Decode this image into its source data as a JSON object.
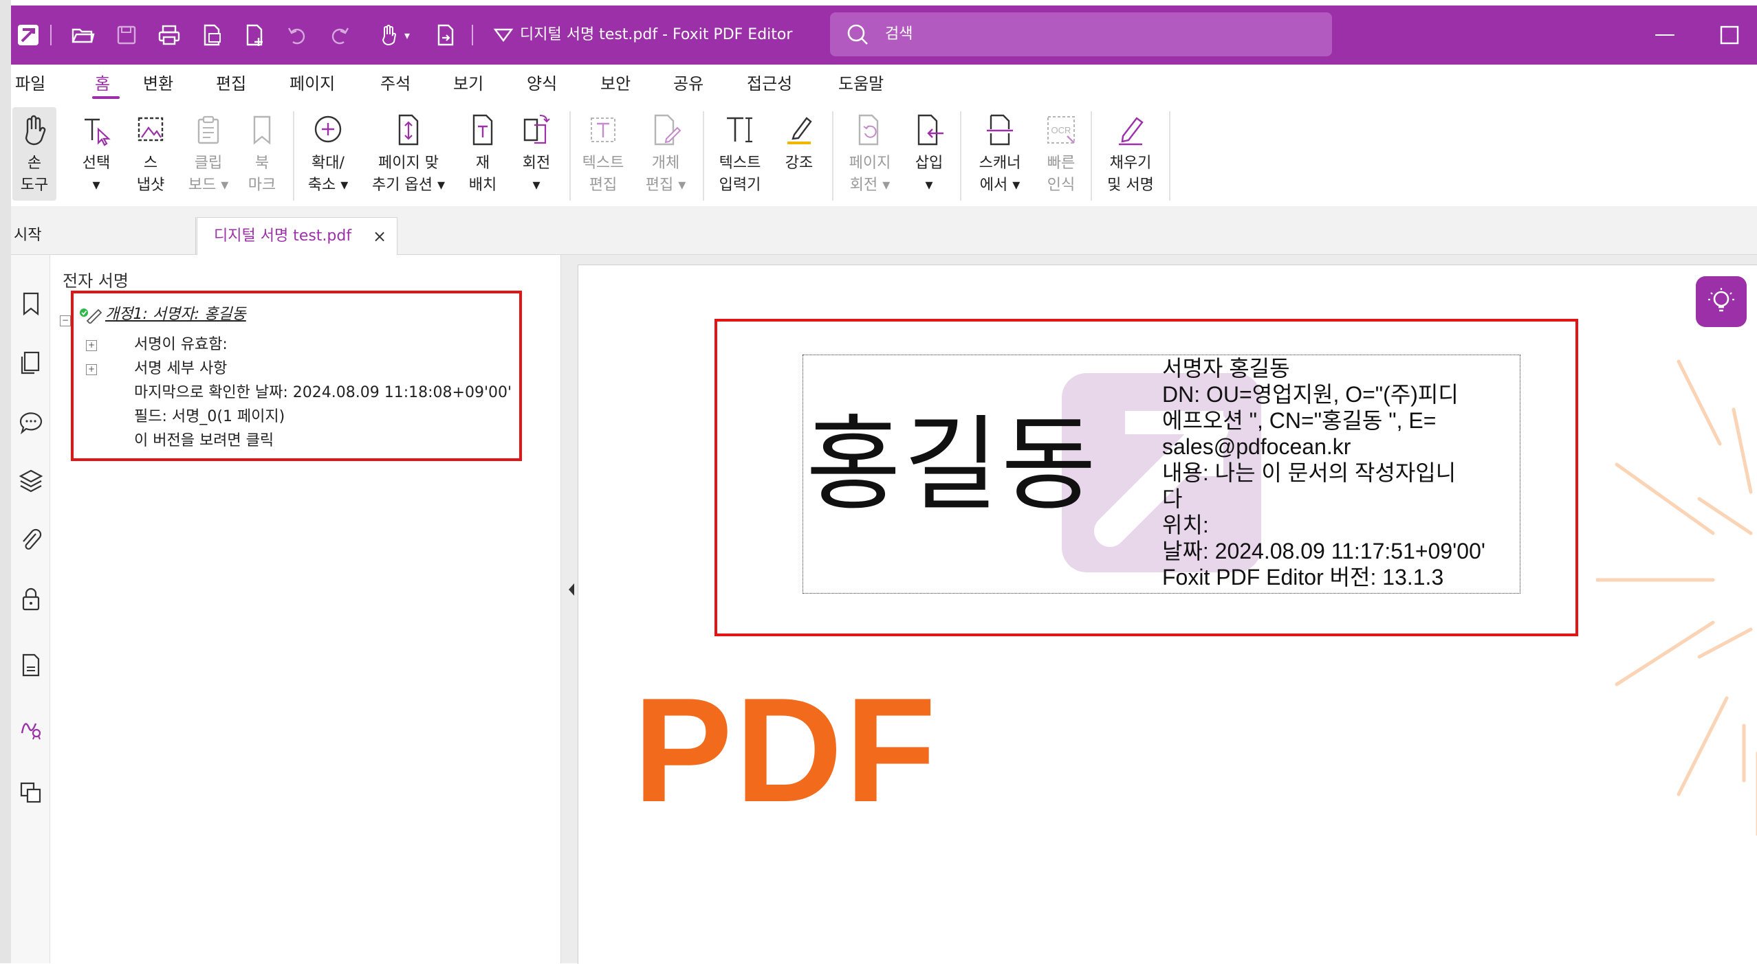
{
  "app": {
    "document_title": "디지털 서명 test.pdf - Foxit PDF Editor",
    "search_placeholder": "검색",
    "accent_color": "#9b30a8"
  },
  "quick_access_icons": [
    "foxit-logo-icon",
    "open-folder-icon",
    "save-icon",
    "print-icon",
    "create-pdf-icon",
    "new-pdf-icon",
    "undo-icon",
    "redo-icon",
    "hand-tool-icon",
    "insert-page-icon",
    "customize-icon"
  ],
  "menu": [
    "파일",
    "홈",
    "변환",
    "편집",
    "페이지",
    "주석",
    "보기",
    "양식",
    "보안",
    "공유",
    "접근성",
    "도움말"
  ],
  "menu_active": "홈",
  "ribbon": [
    {
      "label": "손\n도구",
      "icon": "hand-icon",
      "enabled": true,
      "selected": true
    },
    {
      "label": "선택\n▾",
      "icon": "select-text-icon",
      "enabled": true
    },
    {
      "label": "스\n냅샷",
      "icon": "snapshot-icon",
      "enabled": true
    },
    {
      "label": "클립\n보드 ▾",
      "icon": "clipboard-icon",
      "enabled": false
    },
    {
      "label": "북\n마크",
      "icon": "bookmark-icon",
      "enabled": false
    },
    {
      "label": "확대/\n축소 ▾",
      "icon": "zoom-icon",
      "enabled": true
    },
    {
      "label": "페이지 맞\n추기 옵션 ▾",
      "icon": "fit-page-icon",
      "enabled": true
    },
    {
      "label": "재\n배치",
      "icon": "reflow-icon",
      "enabled": true
    },
    {
      "label": "회전\n▾",
      "icon": "rotate-icon",
      "enabled": true
    },
    {
      "label": "텍스트\n편집",
      "icon": "edit-text-icon",
      "enabled": false
    },
    {
      "label": "개체\n편집 ▾",
      "icon": "edit-object-icon",
      "enabled": false
    },
    {
      "label": "텍스트\n입력기",
      "icon": "typewriter-icon",
      "enabled": true
    },
    {
      "label": "강조",
      "icon": "highlight-icon",
      "enabled": true
    },
    {
      "label": "페이지\n회전 ▾",
      "icon": "rotate-page-icon",
      "enabled": false
    },
    {
      "label": "삽입\n▾",
      "icon": "insert-icon",
      "enabled": true
    },
    {
      "label": "스캐너\n에서 ▾",
      "icon": "scanner-icon",
      "enabled": true
    },
    {
      "label": "빠른\n인식",
      "icon": "ocr-icon",
      "enabled": false
    },
    {
      "label": "채우기\n및 서명",
      "icon": "fill-sign-icon",
      "enabled": true
    }
  ],
  "tabs": {
    "start": "시작",
    "active": "디지털 서명 test.pdf",
    "close": "×"
  },
  "sidebar_icons": [
    "bookmark-icon",
    "pages-icon",
    "comments-icon",
    "layers-icon",
    "attachments-icon",
    "security-icon",
    "document-icon",
    "signature-panel-icon",
    "compare-icon"
  ],
  "signature_panel": {
    "title": "전자 서명",
    "root": "개정1: 서명자: 홍길동",
    "items": [
      {
        "text": "서명이 유효함:",
        "expandable": true
      },
      {
        "text": "서명 세부 사항",
        "expandable": true
      },
      {
        "text": "마지막으로 확인한 날짜: 2024.08.09 11:18:08+09'00'",
        "expandable": false
      },
      {
        "text": "필드: 서명_0(1 페이지)",
        "expandable": false
      },
      {
        "text": "이 버전을 보려면 클릭",
        "expandable": false
      }
    ]
  },
  "document": {
    "signature_name": "홍길동",
    "signature_details": [
      "서명자 홍길동",
      "DN: OU=영업지원, O=\"(주)피디",
      "에프오션 \", CN=\"홍길동 \", E=",
      "sales@pdfocean.kr",
      "내용: 나는 이 문서의 작성자입니",
      "다",
      "위치:",
      "날짜: 2024.08.09 11:17:51+09'00'",
      "Foxit PDF Editor 버전: 13.1.3"
    ],
    "logo_text": "PDF",
    "logo_color": "#f26b1d"
  }
}
